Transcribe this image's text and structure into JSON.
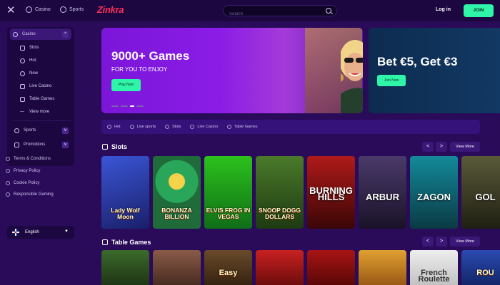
{
  "topbar": {
    "nav": [
      {
        "label": "Casino",
        "icon": "casino-chip-icon"
      },
      {
        "label": "Sports",
        "icon": "sports-ball-icon"
      }
    ],
    "logo": "Zinkra",
    "search_placeholder": "Search",
    "login_label": "Log in",
    "join_label": "JOIN"
  },
  "sidebar": {
    "casino": {
      "label": "Casino",
      "chevron": "^"
    },
    "sub_items": [
      {
        "label": "Slots",
        "icon": "slots-icon"
      },
      {
        "label": "Hot",
        "icon": "flame-icon"
      },
      {
        "label": "New",
        "icon": "new-badge-icon"
      },
      {
        "label": "Live Casino",
        "icon": "live-icon"
      },
      {
        "label": "Table Games",
        "icon": "table-icon"
      },
      {
        "label": "View more",
        "icon": "more-dots-icon"
      }
    ],
    "sports": {
      "label": "Sports",
      "chevron": "v"
    },
    "promotions": {
      "label": "Promotions",
      "chevron": "v"
    },
    "links": [
      {
        "label": "Terms & Conditions"
      },
      {
        "label": "Privacy Policy"
      },
      {
        "label": "Cookie Policy"
      },
      {
        "label": "Responsible Gaming"
      }
    ],
    "language": "English"
  },
  "banners": [
    {
      "title": "9000+ Games",
      "subtitle": "FOR YOU TO ENJOY",
      "button": "Play Now"
    },
    {
      "title": "Bet €5, Get €3",
      "button": "Join Now"
    }
  ],
  "categories": [
    "Hot",
    "Live sports",
    "Slots",
    "Live Casino",
    "Table Games"
  ],
  "sections": [
    {
      "title": "Slots",
      "view_more": "View More",
      "prev": "<",
      "next": ">",
      "tiles": [
        {
          "label": "Lady Wolf Moon",
          "bg": "#2a3ea8"
        },
        {
          "label": "BONANZA BILLION",
          "bg": "#1d8a4a"
        },
        {
          "label": "ELVIS FROG IN VEGAS",
          "bg": "#2f9c1e"
        },
        {
          "label": "SNOOP DOGG DOLLARS",
          "bg": "#3a5a1a"
        },
        {
          "label": "BURNING HILLS",
          "bg": "#7a0f12"
        },
        {
          "label": "ARBUR",
          "bg": "#3a2a5a"
        },
        {
          "label": "ZAGON",
          "bg": "#0f5a6a"
        },
        {
          "label": "GOL",
          "bg": "#3a3a2a"
        }
      ]
    },
    {
      "title": "Table Games",
      "view_more": "View More",
      "prev": "<",
      "next": ">",
      "tiles": [
        {
          "label": "",
          "bg": "#3a5a2a"
        },
        {
          "label": "",
          "bg": "#7a4a3a"
        },
        {
          "label": "Easy",
          "bg": "#5a3a2a"
        },
        {
          "label": "",
          "bg": "#a01a1a"
        },
        {
          "label": "",
          "bg": "#8a1010"
        },
        {
          "label": "",
          "bg": "#c07a20"
        },
        {
          "label": "French Roulette",
          "bg": "#d8d8d8"
        },
        {
          "label": "ROU",
          "bg": "#1a3a8a"
        }
      ]
    }
  ],
  "colors": {
    "accent": "#2ff5a8",
    "brand": "#ff2d55",
    "background": "#2a0b5a",
    "panel": "#1c0740"
  }
}
